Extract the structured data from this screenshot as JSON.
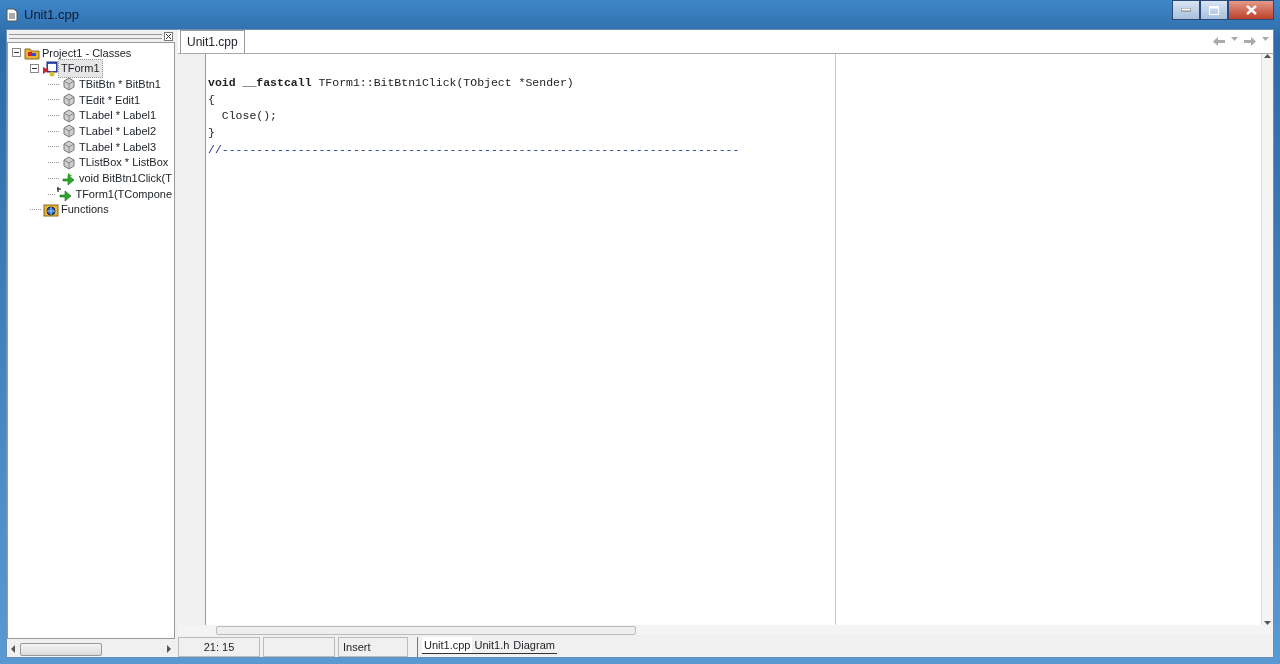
{
  "window": {
    "title": "Unit1.cpp"
  },
  "class_tree": [
    {
      "label": "Project1 - Classes",
      "kind": "project",
      "expanded": true,
      "selected": false,
      "children": [
        {
          "label": "TForm1",
          "kind": "form",
          "expanded": true,
          "selected": true,
          "children": [
            {
              "label": "TBitBtn * BitBtn1",
              "kind": "field",
              "selected": false
            },
            {
              "label": "TEdit * Edit1",
              "kind": "field",
              "selected": false
            },
            {
              "label": "TLabel * Label1",
              "kind": "field",
              "selected": false
            },
            {
              "label": "TLabel * Label2",
              "kind": "field",
              "selected": false
            },
            {
              "label": "TLabel * Label3",
              "kind": "field",
              "selected": false
            },
            {
              "label": "TListBox * ListBox",
              "kind": "field",
              "selected": false
            },
            {
              "label": "void BitBtn1Click(T",
              "kind": "method",
              "selected": false
            },
            {
              "label": "TForm1(TCompone",
              "kind": "constructor",
              "selected": false
            }
          ]
        },
        {
          "label": "Functions",
          "kind": "functions",
          "selected": false
        }
      ]
    }
  ],
  "editor_tabs": [
    {
      "label": "Unit1.cpp",
      "selected": true
    }
  ],
  "code_lines": [
    {
      "kind": "blank"
    },
    {
      "kind": "code",
      "text": "**void** **__fastcall** TForm1::BitBtn1Click(TObject *Sender)"
    },
    {
      "kind": "code",
      "text": "{"
    },
    {
      "kind": "code",
      "text": "  Close();"
    },
    {
      "kind": "code",
      "text": "}"
    },
    {
      "kind": "comment",
      "text": "//---------------------------------------------------------------------------"
    }
  ],
  "status_bar": {
    "position": "21: 15",
    "mode": "Insert"
  },
  "view_tabs": [
    {
      "label": "Unit1.cpp",
      "selected": true
    },
    {
      "label": "Unit1.h",
      "selected": false
    },
    {
      "label": "Diagram",
      "selected": false
    }
  ]
}
